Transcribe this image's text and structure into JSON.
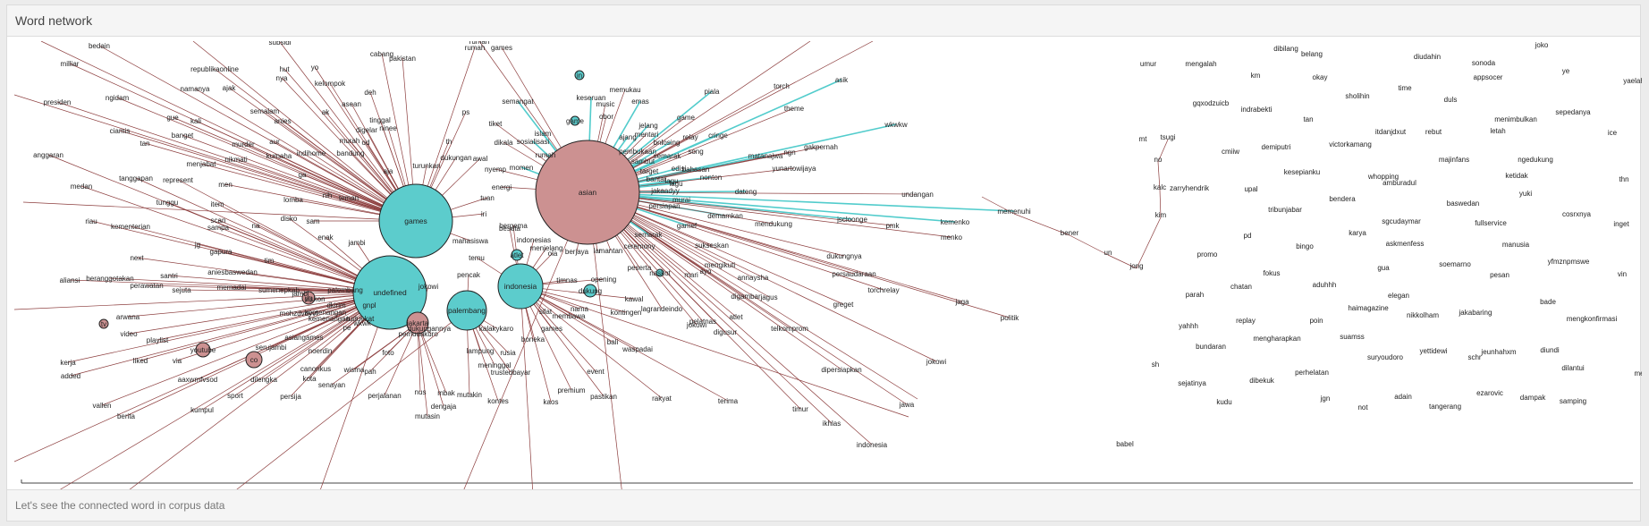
{
  "panel": {
    "title": "Word network",
    "footer": "Let's see the connected word in corpus data"
  },
  "colors": {
    "teal_node": "#5ccccc",
    "pink_node": "#cc9191",
    "teal_edge": "#52cccc",
    "brown_edge": "#8c3d3d"
  },
  "nodes": {
    "asian": "asian",
    "games": "games",
    "undefined": "undefined",
    "indonesia": "indonesia",
    "palembang": "palembang",
    "jakarta": "jakarta",
    "youtube": "youtube",
    "co": "co",
    "yg": "yg",
    "tv": "tv",
    "dukung": "dukung",
    "atlet": "atlet",
    "game": "game",
    "in": "in",
    "naskot": "naskot"
  },
  "words": {
    "w0": "bedain",
    "w1": "subsidi",
    "w2": "cabang",
    "w3": "rumah",
    "w4": "games",
    "w5": "pakistan",
    "w6": "milliar",
    "w7": "republikaonline",
    "w8": "hut",
    "w9": "yo",
    "w10": "nya",
    "w11": "kelompok",
    "w12": "ajak",
    "w13": "namanya",
    "w14": "deh",
    "w15": "ngidam",
    "w16": "presiden",
    "w17": "semalam",
    "w18": "asean",
    "w19": "gue",
    "w20": "kali",
    "w21": "anies",
    "w22": "ak",
    "w23": "tinggal",
    "w24": "ciamis",
    "w25": "banget",
    "w26": "digelar",
    "w27": "ninee",
    "w28": "murah",
    "w29": "od",
    "w30": "tan",
    "w31": "murder",
    "w32": "aur",
    "w33": "kumaha",
    "w34": "indihome",
    "w35": "bandung",
    "w36": "anggaran",
    "w37": "menjabat",
    "w38": "nikmati",
    "w39": "aja",
    "w40": "tanggapan",
    "w41": "represent",
    "w42": "men",
    "w43": "ga",
    "w44": "medan",
    "w45": "tunggu",
    "w46": "item",
    "w47": "lomba",
    "w48": "nih",
    "w49": "teman",
    "w50": "riau",
    "w51": "kementerian",
    "w52": "scan",
    "w53": "sampa",
    "w54": "na",
    "w55": "disko",
    "w56": "sam",
    "w57": "gapura",
    "w58": "jg",
    "w59": "next",
    "w60": "tim",
    "w61": "enak",
    "w62": "jambi",
    "w63": "santri",
    "w64": "aniesbaswedan",
    "w65": "aliansi",
    "w66": "beranggotakan",
    "w67": "perawatan",
    "w68": "sejuta",
    "w69": "memadai",
    "w70": "sumenepkab",
    "w71": "jambi",
    "w72": "palembang",
    "w73": "diskon",
    "w74": "mohzdvdyvf",
    "w75": "kemenangan",
    "w76": "tuduekat",
    "w77": "arwana",
    "w78": "video",
    "w79": "playlist",
    "w80": "liked",
    "w81": "via",
    "w82": "kerja",
    "w83": "added",
    "w84": "serujambi",
    "w85": "asiangames",
    "w86": "noerdin",
    "w87": "canonkus",
    "w88": "kota",
    "w89": "dilengka",
    "w90": "aaxwmfvsod",
    "w91": "sport",
    "w92": "persija",
    "w93": "senayan",
    "w94": "wisma",
    "w95": "pah",
    "w96": "perjalanan",
    "w97": "vallen",
    "w98": "kumpul",
    "w99": "berita",
    "w100": "foto",
    "w101": "nus",
    "w102": "mbak",
    "w103": "mutakin",
    "w104": "dengaja",
    "w105": "mutasin",
    "w106": "dukungannya",
    "w107": "pemuda",
    "w108": "kuro",
    "w109": "pe",
    "w110": "wkwk",
    "w111": "gnpl",
    "w112": "dkirim",
    "w113": "kemenangan",
    "w114": "kalakykaro",
    "w115": "lampung",
    "w116": "rusia",
    "w117": "meninggal",
    "w118": "trustedbayar",
    "w119": "kontes",
    "w120": "boneka",
    "w121": "games",
    "w122": "silat",
    "w123": "membawa",
    "w124": "nama",
    "w125": "kaos",
    "w126": "premium",
    "w127": "event",
    "w128": "pastikan",
    "w129": "rakyat",
    "w130": "terima",
    "w131": "bali",
    "w132": "waspadai",
    "w133": "kontingen",
    "w134": "lagrandeindo",
    "w135": "kawal",
    "w136": "timnas",
    "w137": "opening",
    "w138": "mantan",
    "w139": "jokowi",
    "w140": "digusur",
    "w141": "pelatnas",
    "w142": "ayo",
    "w143": "atlet",
    "w144": "telkomprom",
    "w145": "dipersiapkan",
    "w146": "timur",
    "w147": "ikhlas",
    "w148": "jokowi",
    "w149": "jawa",
    "w150": "indonesia",
    "w151": "babel",
    "w152": "pencak",
    "w153": "temu",
    "w154": "mahasiswa",
    "w155": "jokowi",
    "w156": "besuta",
    "w157": "berjaya",
    "w158": "menjelang",
    "w159": "ola",
    "w160": "lar",
    "w161": "ceremony",
    "w162": "peserta",
    "w163": "mari",
    "w164": "mengikuti",
    "w165": "annaysha",
    "w166": "digambar",
    "w167": "jagus",
    "w168": "sukseskan",
    "w169": "greget",
    "w170": "semarak",
    "w171": "torchrelay",
    "w172": "jaga",
    "w173": "politik",
    "w174": "persaudaraan",
    "w175": "dukungnya",
    "w176": "demamkan",
    "w177": "mendukung",
    "w178": "jscloonge",
    "w179": "pmk",
    "w180": "kemenko",
    "w181": "menko",
    "w182": "dateng",
    "w183": "undangan",
    "w184": "memenuhi",
    "w185": "bener",
    "w186": "un",
    "w187": "jong",
    "w188": "nonton",
    "w189": "yunartowijaya",
    "w190": "matanajwa",
    "w191": "gakpernah",
    "w192": "wkwkw",
    "w193": "theme",
    "w194": "asik",
    "w195": "torch",
    "w196": "piala",
    "w197": "memukau",
    "w198": "emas",
    "w199": "music",
    "w200": "keseruan",
    "w201": "obor",
    "w202": "semangat",
    "w203": "tiket",
    "w204": "islam",
    "w205": "dikala",
    "w206": "sosialisasi",
    "w207": "rumah",
    "w208": "jelang",
    "w209": "mentari",
    "w210": "ajang",
    "w211": "relay",
    "w212": "cringe",
    "w213": "game",
    "w214": "lagu",
    "w215": "song",
    "w216": "semarak",
    "w217": "bni",
    "w218": "losing",
    "w219": "pembukaan",
    "w220": "sambut",
    "w221": "ngn",
    "w222": "edisi",
    "w223": "target",
    "w224": "bantar",
    "w225": "bahasan",
    "w226": "lagu",
    "w227": "jakaadyy",
    "w228": "murai",
    "w229": "persiapan",
    "w230": "gamef",
    "w231": "energi",
    "w232": "tuan",
    "w233": "nyemp",
    "w234": "momen",
    "w235": "dukungan",
    "w236": "awal",
    "w237": "turunkan",
    "w238": "th",
    "w239": "ps",
    "w240": "iri",
    "w241": "bergema",
    "w242": "indonesias",
    "w243": "rumah",
    "r0": "joko",
    "r1": "dibilang",
    "r2": "umur",
    "r3": "mengalah",
    "r4": "belang",
    "r5": "diudahin",
    "r6": "sonoda",
    "r7": "ye",
    "r8": "km",
    "r9": "okay",
    "r10": "appsocer",
    "r11": "yaelah",
    "r12": "time",
    "r13": "sholihin",
    "r14": "duls",
    "r15": "gqxodzuicb",
    "r16": "indrabekti",
    "r17": "sepedanya",
    "r18": "tan",
    "r19": "menimbulkan",
    "r20": "itdanjdxut",
    "r21": "rebut",
    "r22": "letah",
    "r23": "ice",
    "r24": "mt",
    "r25": "tsugi",
    "r26": "demiputri",
    "r27": "victorkamang",
    "r28": "cmiiw",
    "r29": "no",
    "r30": "majinfans",
    "r31": "ngedukung",
    "r32": "kesepianku",
    "r33": "whopping",
    "r34": "ketidak",
    "r35": "thn",
    "r36": "kalc",
    "r37": "zarryhendrik",
    "r38": "upal",
    "r39": "amburadul",
    "r40": "yuki",
    "r41": "bendera",
    "r42": "baswedan",
    "r43": "kim",
    "r44": "tribunjabar",
    "r45": "sgcudaymar",
    "r46": "fullservice",
    "r47": "cosrxnya",
    "r48": "inget",
    "r49": "pd",
    "r50": "karya",
    "r51": "askmenfess",
    "r52": "bingo",
    "r53": "manusia",
    "r54": "promo",
    "r55": "soemarno",
    "r56": "yfmznpmswe",
    "r57": "fokus",
    "r58": "gua",
    "r59": "pesan",
    "r60": "vin",
    "r61": "chatan",
    "r62": "aduhhh",
    "r63": "parah",
    "r64": "elegan",
    "r65": "bade",
    "r66": "haimagazine",
    "r67": "jakabaring",
    "r68": "nikkolham",
    "r69": "mengkonfirmasi",
    "r70": "replay",
    "r71": "poin",
    "r72": "yahhh",
    "r73": "mengharapkan",
    "r74": "suamss",
    "r75": "bundaran",
    "r76": "yettidewi",
    "r77": "jeunhahxm",
    "r78": "diundi",
    "r79": "schr",
    "r80": "suryoudoro",
    "r81": "sh",
    "r82": "perhelatan",
    "r83": "dilantui",
    "r84": "me",
    "r85": "sejatinya",
    "r86": "dibekuk",
    "r87": "ezarovic",
    "r88": "dampak",
    "r89": "adain",
    "r90": "kudu",
    "r91": "jgn",
    "r92": "tangerang",
    "r93": "samping",
    "r94": "not",
    "r95": "yoocinda"
  }
}
